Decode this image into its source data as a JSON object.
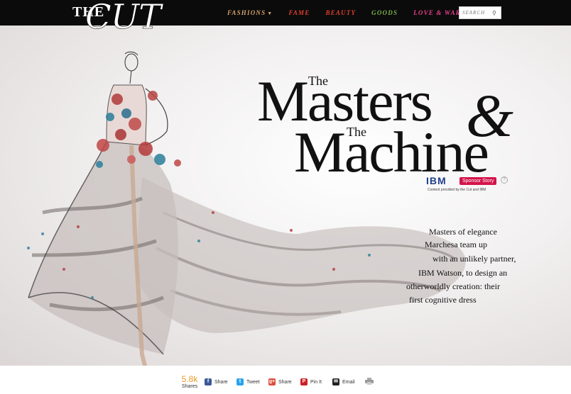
{
  "header": {
    "logo_the": "THE",
    "logo_cut": "CUT",
    "nav": [
      {
        "label": "FASHIONS",
        "color": "#d4a36a"
      },
      {
        "label": "FAME",
        "color": "#e2402e"
      },
      {
        "label": "BEAUTY",
        "color": "#e2402e"
      },
      {
        "label": "GOODS",
        "color": "#7ab44a"
      },
      {
        "label": "LOVE & WAR",
        "color": "#ea3e8e"
      }
    ],
    "search_placeholder": "SEARCH",
    "search_icon": "magnifier-icon"
  },
  "hero": {
    "title_the_1": "The",
    "title_masters": "Masters",
    "title_amp": "&",
    "title_the_2": "The",
    "title_machine": "Machine",
    "sponsor_logo": "IBM",
    "sponsor_badge": "Sponsor Story",
    "help_icon": "?",
    "provided_by": "Content provided by the Cut and IBM",
    "blurb_lines": [
      "Masters of elegance",
      "Marchesa team up",
      "with an unlikely partner,",
      "IBM Watson, to design an",
      "otherworldly creation: their",
      "first cognitive dress"
    ]
  },
  "share": {
    "count": "5.8k",
    "count_label": "Shares",
    "buttons": [
      {
        "icon": "facebook-icon",
        "glyph": "f",
        "color": "#3b5998",
        "label": "Share"
      },
      {
        "icon": "twitter-icon",
        "glyph": "t",
        "color": "#2aa3ef",
        "label": "Tweet"
      },
      {
        "icon": "google-plus-icon",
        "glyph": "g+",
        "color": "#dd4b39",
        "label": "Share"
      },
      {
        "icon": "pinterest-icon",
        "glyph": "P",
        "color": "#cb2027",
        "label": "Pin It"
      },
      {
        "icon": "email-icon",
        "glyph": "✉",
        "color": "#222222",
        "label": "Email"
      }
    ],
    "print_icon": "print-icon"
  }
}
